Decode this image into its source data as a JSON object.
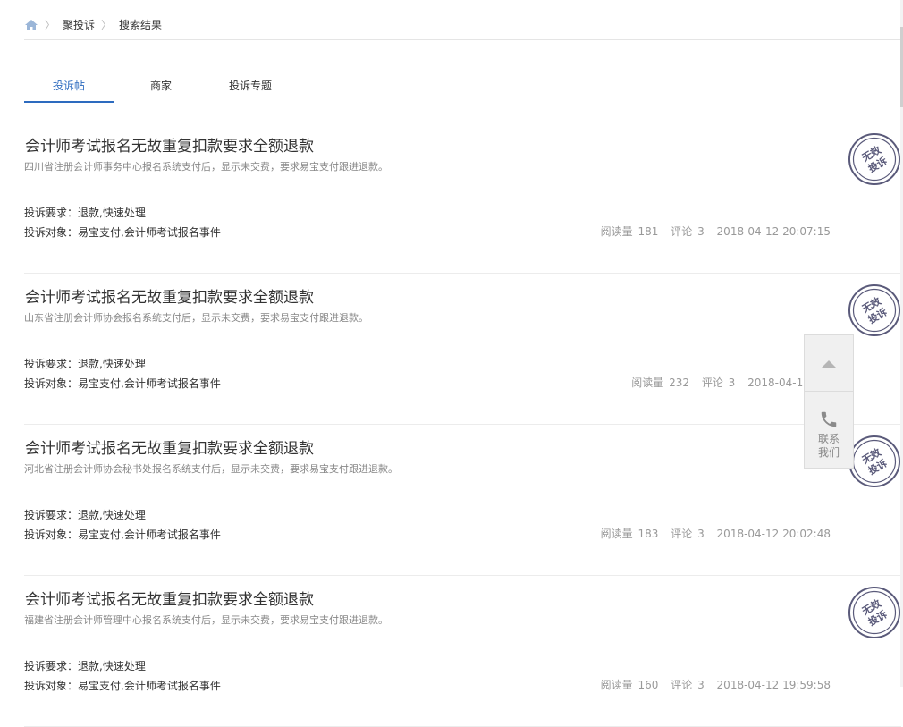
{
  "breadcrumb": {
    "home_icon": "home-icon",
    "items": [
      "聚投诉",
      "搜索结果"
    ],
    "separator": "〉"
  },
  "tabs": [
    {
      "label": "投诉帖",
      "active": true
    },
    {
      "label": "商家",
      "active": false
    },
    {
      "label": "投诉专题",
      "active": false
    }
  ],
  "labels": {
    "requirement": "投诉要求：",
    "target": "投诉对象：",
    "read": "阅读量",
    "comment": "评论"
  },
  "stamp_text": [
    "无效",
    "投诉"
  ],
  "complaints": [
    {
      "title": "会计师考试报名无故重复扣款要求全额退款",
      "desc": "四川省注册会计师事务中心报名系统支付后，显示未交费，要求易宝支付跟进退款。",
      "requirement": "退款,快速处理",
      "target": "易宝支付,会计师考试报名事件",
      "reads": "181",
      "comments": "3",
      "time": "2018-04-12 20:07:15"
    },
    {
      "title": "会计师考试报名无故重复扣款要求全额退款",
      "desc": "山东省注册会计师协会报名系统支付后，显示未交费，要求易宝支付跟进退款。",
      "requirement": "退款,快速处理",
      "target": "易宝支付,会计师考试报名事件",
      "reads": "232",
      "comments": "3",
      "time": "2018-04-12 20:"
    },
    {
      "title": "会计师考试报名无故重复扣款要求全额退款",
      "desc": "河北省注册会计师协会秘书处报名系统支付后，显示未交费，要求易宝支付跟进退款。",
      "requirement": "退款,快速处理",
      "target": "易宝支付,会计师考试报名事件",
      "reads": "183",
      "comments": "3",
      "time": "2018-04-12 20:02:48"
    },
    {
      "title": "会计师考试报名无故重复扣款要求全额退款",
      "desc": "福建省注册会计师管理中心报名系统支付后，显示未交费，要求易宝支付跟进退款。",
      "requirement": "退款,快速处理",
      "target": "易宝支付,会计师考试报名事件",
      "reads": "160",
      "comments": "3",
      "time": "2018-04-12 19:59:58"
    }
  ],
  "float_panel": {
    "up_icon": "arrow-up-icon",
    "phone_icon": "phone-icon",
    "contact_label": "联系我们"
  },
  "colors": {
    "accent": "#2d6bbf",
    "stamp": "#5a5a7a"
  }
}
